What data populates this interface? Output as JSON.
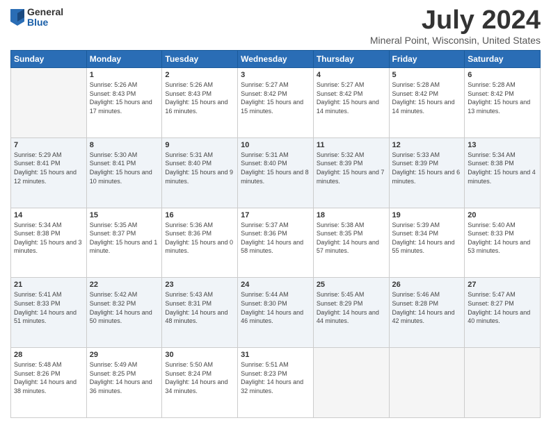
{
  "logo": {
    "general": "General",
    "blue": "Blue"
  },
  "header": {
    "month": "July 2024",
    "location": "Mineral Point, Wisconsin, United States"
  },
  "weekdays": [
    "Sunday",
    "Monday",
    "Tuesday",
    "Wednesday",
    "Thursday",
    "Friday",
    "Saturday"
  ],
  "weeks": [
    [
      {
        "day": "",
        "sunrise": "",
        "sunset": "",
        "daylight": "",
        "empty": true
      },
      {
        "day": "1",
        "sunrise": "Sunrise: 5:26 AM",
        "sunset": "Sunset: 8:43 PM",
        "daylight": "Daylight: 15 hours and 17 minutes."
      },
      {
        "day": "2",
        "sunrise": "Sunrise: 5:26 AM",
        "sunset": "Sunset: 8:43 PM",
        "daylight": "Daylight: 15 hours and 16 minutes."
      },
      {
        "day": "3",
        "sunrise": "Sunrise: 5:27 AM",
        "sunset": "Sunset: 8:42 PM",
        "daylight": "Daylight: 15 hours and 15 minutes."
      },
      {
        "day": "4",
        "sunrise": "Sunrise: 5:27 AM",
        "sunset": "Sunset: 8:42 PM",
        "daylight": "Daylight: 15 hours and 14 minutes."
      },
      {
        "day": "5",
        "sunrise": "Sunrise: 5:28 AM",
        "sunset": "Sunset: 8:42 PM",
        "daylight": "Daylight: 15 hours and 14 minutes."
      },
      {
        "day": "6",
        "sunrise": "Sunrise: 5:28 AM",
        "sunset": "Sunset: 8:42 PM",
        "daylight": "Daylight: 15 hours and 13 minutes."
      }
    ],
    [
      {
        "day": "7",
        "sunrise": "Sunrise: 5:29 AM",
        "sunset": "Sunset: 8:41 PM",
        "daylight": "Daylight: 15 hours and 12 minutes."
      },
      {
        "day": "8",
        "sunrise": "Sunrise: 5:30 AM",
        "sunset": "Sunset: 8:41 PM",
        "daylight": "Daylight: 15 hours and 10 minutes."
      },
      {
        "day": "9",
        "sunrise": "Sunrise: 5:31 AM",
        "sunset": "Sunset: 8:40 PM",
        "daylight": "Daylight: 15 hours and 9 minutes."
      },
      {
        "day": "10",
        "sunrise": "Sunrise: 5:31 AM",
        "sunset": "Sunset: 8:40 PM",
        "daylight": "Daylight: 15 hours and 8 minutes."
      },
      {
        "day": "11",
        "sunrise": "Sunrise: 5:32 AM",
        "sunset": "Sunset: 8:39 PM",
        "daylight": "Daylight: 15 hours and 7 minutes."
      },
      {
        "day": "12",
        "sunrise": "Sunrise: 5:33 AM",
        "sunset": "Sunset: 8:39 PM",
        "daylight": "Daylight: 15 hours and 6 minutes."
      },
      {
        "day": "13",
        "sunrise": "Sunrise: 5:34 AM",
        "sunset": "Sunset: 8:38 PM",
        "daylight": "Daylight: 15 hours and 4 minutes."
      }
    ],
    [
      {
        "day": "14",
        "sunrise": "Sunrise: 5:34 AM",
        "sunset": "Sunset: 8:38 PM",
        "daylight": "Daylight: 15 hours and 3 minutes."
      },
      {
        "day": "15",
        "sunrise": "Sunrise: 5:35 AM",
        "sunset": "Sunset: 8:37 PM",
        "daylight": "Daylight: 15 hours and 1 minute."
      },
      {
        "day": "16",
        "sunrise": "Sunrise: 5:36 AM",
        "sunset": "Sunset: 8:36 PM",
        "daylight": "Daylight: 15 hours and 0 minutes."
      },
      {
        "day": "17",
        "sunrise": "Sunrise: 5:37 AM",
        "sunset": "Sunset: 8:36 PM",
        "daylight": "Daylight: 14 hours and 58 minutes."
      },
      {
        "day": "18",
        "sunrise": "Sunrise: 5:38 AM",
        "sunset": "Sunset: 8:35 PM",
        "daylight": "Daylight: 14 hours and 57 minutes."
      },
      {
        "day": "19",
        "sunrise": "Sunrise: 5:39 AM",
        "sunset": "Sunset: 8:34 PM",
        "daylight": "Daylight: 14 hours and 55 minutes."
      },
      {
        "day": "20",
        "sunrise": "Sunrise: 5:40 AM",
        "sunset": "Sunset: 8:33 PM",
        "daylight": "Daylight: 14 hours and 53 minutes."
      }
    ],
    [
      {
        "day": "21",
        "sunrise": "Sunrise: 5:41 AM",
        "sunset": "Sunset: 8:33 PM",
        "daylight": "Daylight: 14 hours and 51 minutes."
      },
      {
        "day": "22",
        "sunrise": "Sunrise: 5:42 AM",
        "sunset": "Sunset: 8:32 PM",
        "daylight": "Daylight: 14 hours and 50 minutes."
      },
      {
        "day": "23",
        "sunrise": "Sunrise: 5:43 AM",
        "sunset": "Sunset: 8:31 PM",
        "daylight": "Daylight: 14 hours and 48 minutes."
      },
      {
        "day": "24",
        "sunrise": "Sunrise: 5:44 AM",
        "sunset": "Sunset: 8:30 PM",
        "daylight": "Daylight: 14 hours and 46 minutes."
      },
      {
        "day": "25",
        "sunrise": "Sunrise: 5:45 AM",
        "sunset": "Sunset: 8:29 PM",
        "daylight": "Daylight: 14 hours and 44 minutes."
      },
      {
        "day": "26",
        "sunrise": "Sunrise: 5:46 AM",
        "sunset": "Sunset: 8:28 PM",
        "daylight": "Daylight: 14 hours and 42 minutes."
      },
      {
        "day": "27",
        "sunrise": "Sunrise: 5:47 AM",
        "sunset": "Sunset: 8:27 PM",
        "daylight": "Daylight: 14 hours and 40 minutes."
      }
    ],
    [
      {
        "day": "28",
        "sunrise": "Sunrise: 5:48 AM",
        "sunset": "Sunset: 8:26 PM",
        "daylight": "Daylight: 14 hours and 38 minutes."
      },
      {
        "day": "29",
        "sunrise": "Sunrise: 5:49 AM",
        "sunset": "Sunset: 8:25 PM",
        "daylight": "Daylight: 14 hours and 36 minutes."
      },
      {
        "day": "30",
        "sunrise": "Sunrise: 5:50 AM",
        "sunset": "Sunset: 8:24 PM",
        "daylight": "Daylight: 14 hours and 34 minutes."
      },
      {
        "day": "31",
        "sunrise": "Sunrise: 5:51 AM",
        "sunset": "Sunset: 8:23 PM",
        "daylight": "Daylight: 14 hours and 32 minutes."
      },
      {
        "day": "",
        "sunrise": "",
        "sunset": "",
        "daylight": "",
        "empty": true
      },
      {
        "day": "",
        "sunrise": "",
        "sunset": "",
        "daylight": "",
        "empty": true
      },
      {
        "day": "",
        "sunrise": "",
        "sunset": "",
        "daylight": "",
        "empty": true
      }
    ]
  ]
}
